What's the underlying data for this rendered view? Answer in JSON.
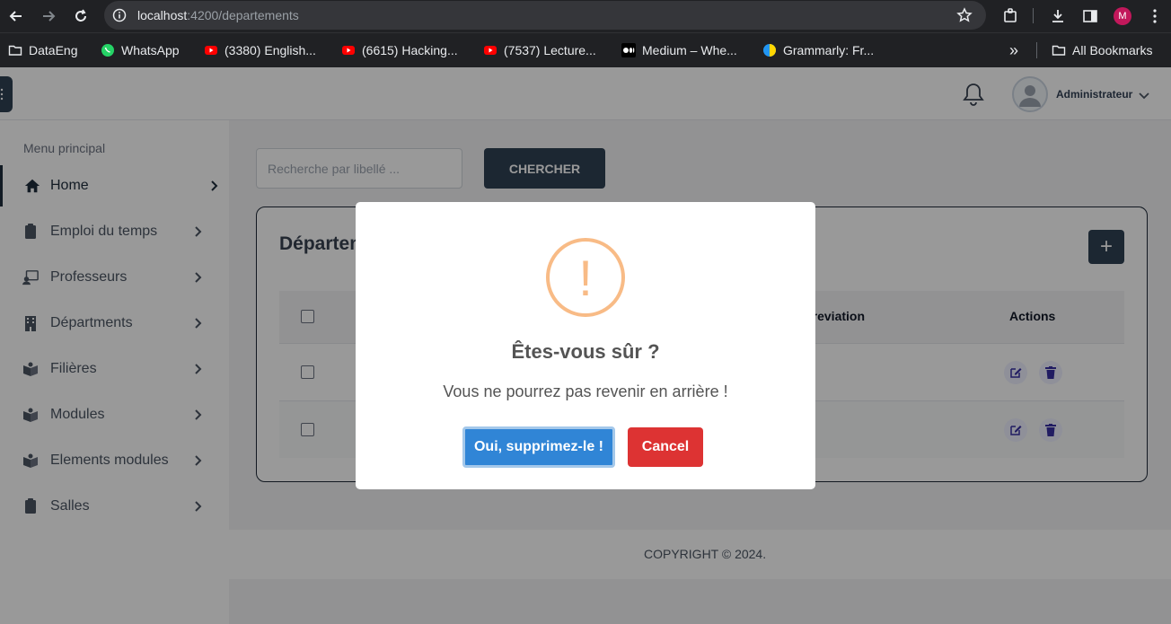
{
  "browser": {
    "url_host": "localhost",
    "url_path": ":4200/departements",
    "profile_initial": "M",
    "bookmarks": [
      {
        "label": "DataEng",
        "icon": "folder-icon"
      },
      {
        "label": "WhatsApp",
        "icon": "whatsapp-icon"
      },
      {
        "label": "(3380) English...",
        "icon": "youtube-icon"
      },
      {
        "label": "(6615) Hacking...",
        "icon": "youtube-icon"
      },
      {
        "label": "(7537) Lecture...",
        "icon": "youtube-icon"
      },
      {
        "label": "Medium – Whe...",
        "icon": "medium-icon"
      },
      {
        "label": "Grammarly: Fr...",
        "icon": "grammarly-icon"
      }
    ],
    "more_bookmarks": "»",
    "all_bookmarks": "All Bookmarks"
  },
  "header": {
    "user_name": "Administrateur"
  },
  "sidebar": {
    "title": "Menu principal",
    "items": [
      {
        "label": "Home",
        "icon": "home-icon"
      },
      {
        "label": "Emploi du temps",
        "icon": "clipboard-icon"
      },
      {
        "label": "Professeurs",
        "icon": "teacher-icon"
      },
      {
        "label": "Départments",
        "icon": "building-icon"
      },
      {
        "label": "Filières",
        "icon": "book-icon"
      },
      {
        "label": "Modules",
        "icon": "book-icon"
      },
      {
        "label": "Elements modules",
        "icon": "book-icon"
      },
      {
        "label": "Salles",
        "icon": "clipboard-icon"
      }
    ]
  },
  "search": {
    "placeholder": "Recherche par libellé ...",
    "button": "CHERCHER"
  },
  "card": {
    "title": "Départements",
    "add_label": "+",
    "columns": [
      "Abreviation",
      "Actions"
    ]
  },
  "modal": {
    "icon": "!",
    "title": "Êtes-vous sûr ?",
    "text": "Vous ne pourrez pas revenir en arrière !",
    "confirm": "Oui, supprimez-le !",
    "cancel": "Cancel"
  },
  "footer": {
    "text": "COPYRIGHT © 2024."
  },
  "colors": {
    "primary": "#2f4154",
    "confirm": "#3085d6",
    "cancel": "#dd3333",
    "warning": "#f8bb86"
  }
}
